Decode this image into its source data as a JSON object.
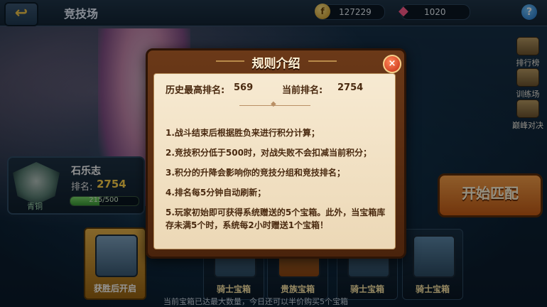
{
  "header": {
    "title": "竞技场",
    "back_icon": "↩",
    "gold": "127229",
    "gems": "1020",
    "help_icon": "?"
  },
  "sidebar": {
    "items": [
      {
        "label": "排行榜",
        "icon": "leaderboard-icon"
      },
      {
        "label": "训练场",
        "icon": "target-icon"
      },
      {
        "label": "巅峰对决",
        "icon": "camera-icon"
      }
    ]
  },
  "player": {
    "name": "石乐志",
    "rank_label": "排名:",
    "rank_value": "2754",
    "tier": "青铜",
    "progress_text": "215/500",
    "progress": 0.43
  },
  "start_button": "开始匹配",
  "chests": [
    {
      "label": "获胜后开启"
    },
    {
      "label": "骑士宝箱"
    },
    {
      "label": "贵族宝箱"
    },
    {
      "label": "骑士宝箱"
    },
    {
      "label": "骑士宝箱"
    }
  ],
  "footer_text": "当前宝箱已达最大数量，今日还可以半价购买5个宝箱",
  "modal": {
    "title": "规则介绍",
    "close_icon": "×",
    "history_label": "历史最高排名:",
    "history_value": "569",
    "current_label": "当前排名:",
    "current_value": "2754",
    "rules": [
      "1.战斗结束后根据胜负来进行积分计算；",
      "2.竞技积分低于500时，对战失败不会扣减当前积分；",
      "3.积分的升降会影响你的竞技分组和竞技排名；",
      "4.排名每5分钟自动刷新；",
      "5.玩家初始即可获得系统赠送的5个宝箱。此外，当宝箱库存未满5个时，系统每2小时赠送1个宝箱！"
    ]
  }
}
